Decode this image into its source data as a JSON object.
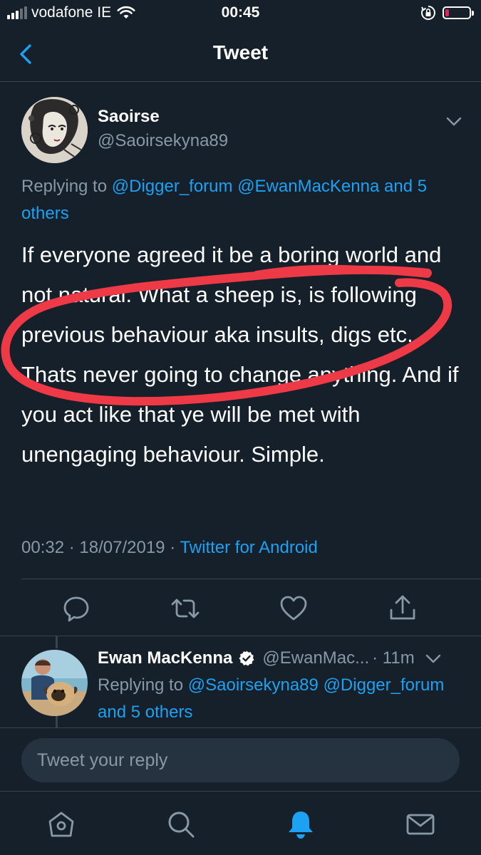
{
  "status_bar": {
    "carrier": "vodafone IE",
    "time": "00:45"
  },
  "nav": {
    "title": "Tweet",
    "back_icon": "chevron-left-icon"
  },
  "tweet": {
    "author_name": "Saoirse",
    "author_handle": "@Saoirsekyna89",
    "replying_prefix": "Replying to",
    "replying_mention_1": "@Digger_forum",
    "replying_mention_2": "@EwanMacKenna",
    "replying_others": "and 5 others",
    "text": "If everyone agreed it be a boring world and not natural. What a sheep is, is following previous behaviour aka insults, digs etc. Thats never going to change anything. And if you act like that ye will be met with unengaging behaviour. Simple.",
    "time": "00:32",
    "date": "18/07/2019",
    "separator": "·",
    "source": "Twitter for Android"
  },
  "actions": {
    "reply_icon": "comment-icon",
    "retweet_icon": "retweet-icon",
    "like_icon": "heart-icon",
    "share_icon": "share-icon"
  },
  "reply": {
    "author_name": "Ewan MacKenna",
    "verified_icon": "verified-badge-icon",
    "author_handle": "@EwanMac...",
    "age": "· 11m",
    "replying_prefix": "Replying to",
    "replying_mention_1": "@Saoirsekyna89",
    "replying_mention_2": "@Digger_forum",
    "replying_others": "and 5 others"
  },
  "composer": {
    "placeholder": "Tweet your reply"
  },
  "tab_bar": [
    "home-icon",
    "search-icon",
    "notifications-icon",
    "messages-icon"
  ],
  "colors": {
    "background": "#15202b",
    "accent": "#1da1f2",
    "secondary_text": "#8899a6",
    "annotation": "#ee3a46"
  }
}
